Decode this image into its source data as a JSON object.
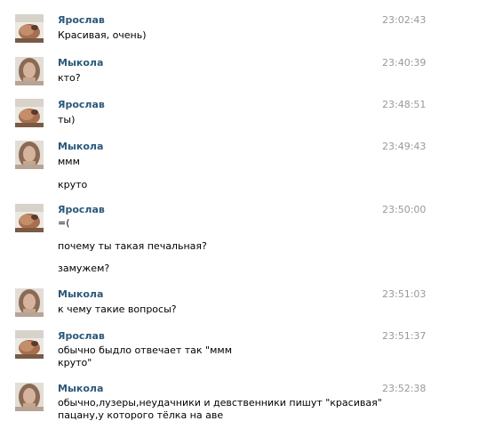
{
  "messages": [
    {
      "author": "Ярослав",
      "time": "23:02:43",
      "avatar": "male-avatar",
      "lines": [
        "Красивая, очень)"
      ]
    },
    {
      "author": "Мыкола",
      "time": "23:40:39",
      "avatar": "female-avatar",
      "lines": [
        "кто?"
      ]
    },
    {
      "author": "Ярослав",
      "time": "23:48:51",
      "avatar": "male-avatar",
      "lines": [
        "ты)"
      ]
    },
    {
      "author": "Мыкола",
      "time": "23:49:43",
      "avatar": "female-avatar",
      "lines": [
        "ммм",
        "круто"
      ]
    },
    {
      "author": "Ярослав",
      "time": "23:50:00",
      "avatar": "male-avatar",
      "lines": [
        "=(",
        "почему ты такая печальная?",
        "замужем?"
      ]
    },
    {
      "author": "Мыкола",
      "time": "23:51:03",
      "avatar": "female-avatar",
      "lines": [
        "к чему такие вопросы?"
      ]
    },
    {
      "author": "Ярослав",
      "time": "23:51:37",
      "avatar": "male-avatar",
      "lines": [
        "обычно быдло отвечает так \"ммм",
        "круто\""
      ]
    },
    {
      "author": "Мыкола",
      "time": "23:52:38",
      "avatar": "female-avatar",
      "lines": [
        "обычно,лузеры,неудачники и девственники пишут \"красивая\"",
        "пацану,у которого тёлка на аве"
      ]
    }
  ],
  "colors": {
    "author": "#2b587a",
    "time": "#999999",
    "text": "#000000",
    "background": "#ffffff"
  }
}
